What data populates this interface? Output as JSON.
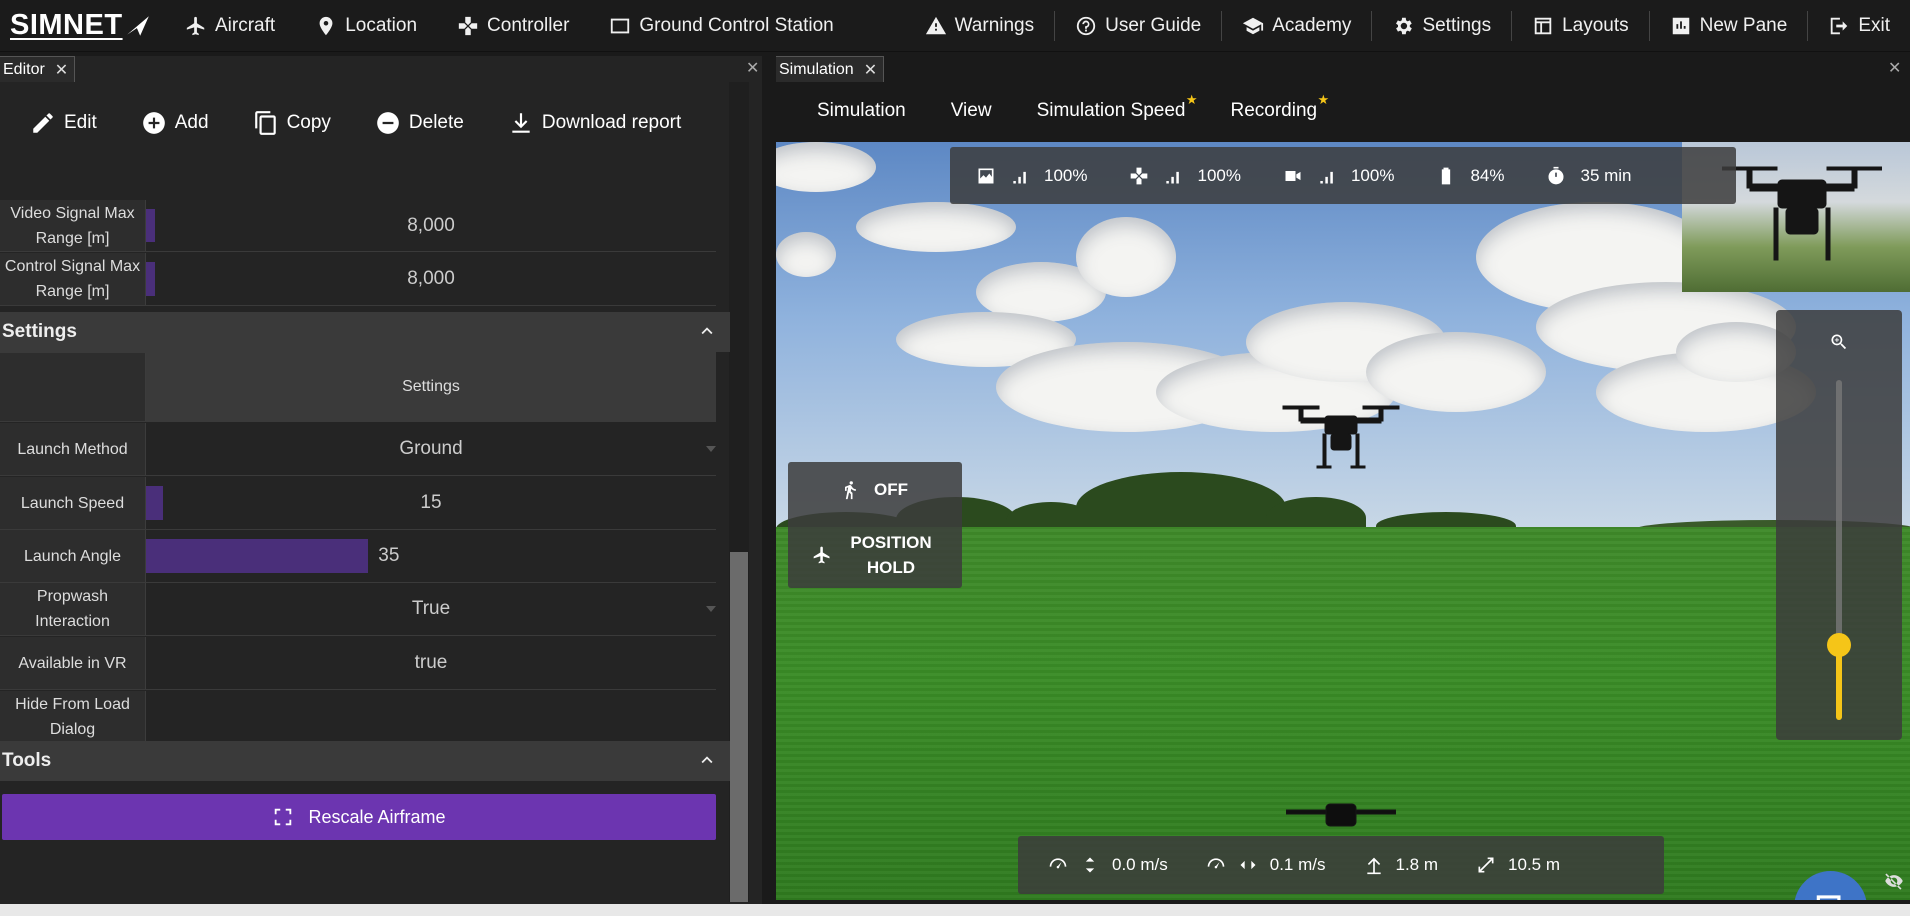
{
  "app": {
    "logo": "SIMNET"
  },
  "nav": {
    "left": [
      {
        "label": "Aircraft",
        "icon": "airplane-icon"
      },
      {
        "label": "Location",
        "icon": "map-pin-icon"
      },
      {
        "label": "Controller",
        "icon": "gamepad-icon"
      },
      {
        "label": "Ground Control Station",
        "icon": "monitor-icon"
      }
    ],
    "right": [
      {
        "label": "Warnings",
        "icon": "warning-icon"
      },
      {
        "label": "User Guide",
        "icon": "help-icon"
      },
      {
        "label": "Academy",
        "icon": "graduation-cap-icon"
      },
      {
        "label": "Settings",
        "icon": "gear-icon"
      },
      {
        "label": "Layouts",
        "icon": "layout-icon"
      },
      {
        "label": "New Pane",
        "icon": "chart-icon"
      },
      {
        "label": "Exit",
        "icon": "exit-icon"
      }
    ]
  },
  "editor": {
    "tab": "Editor",
    "toolbar": {
      "edit": "Edit",
      "add": "Add",
      "copy": "Copy",
      "delete": "Delete",
      "download": "Download report"
    },
    "top_rows": [
      {
        "label": "Video Signal Max Range [m]",
        "value": "8,000",
        "fill": 0.015
      },
      {
        "label": "Control Signal Max Range [m]",
        "value": "8,000",
        "fill": 0.015
      }
    ],
    "settings_section": {
      "title": "Settings",
      "header": "Settings",
      "rows": [
        {
          "label": "Launch Method",
          "value": "Ground",
          "dropdown": true
        },
        {
          "label": "Launch Speed",
          "value": "15",
          "fill": 0.03
        },
        {
          "label": "Launch Angle",
          "value": "35",
          "fill": 0.39
        },
        {
          "label": "Propwash Interaction",
          "value": "True",
          "dropdown": true
        },
        {
          "label": "Available in VR",
          "value": "true"
        },
        {
          "label": "Hide From Load Dialog",
          "value": ""
        }
      ]
    },
    "tools_section": {
      "title": "Tools",
      "rescale": "Rescale Airframe"
    }
  },
  "simulation": {
    "tab": "Simulation",
    "menu": [
      {
        "label": "Simulation",
        "star": false
      },
      {
        "label": "View",
        "star": false
      },
      {
        "label": "Simulation Speed",
        "star": true
      },
      {
        "label": "Recording",
        "star": true
      }
    ],
    "hud_top": {
      "video_signal": "100%",
      "control_signal": "100%",
      "camera_signal": "100%",
      "battery": "84%",
      "time": "35 min"
    },
    "mode": {
      "first": "OFF",
      "second": "POSITION HOLD"
    },
    "hud_bottom": {
      "vertical_speed": "0.0 m/s",
      "horizontal_speed": "0.1 m/s",
      "altitude": "1.8 m",
      "distance": "10.5 m"
    },
    "zoom_level": 0.22,
    "colors": {
      "accent": "#f5c518",
      "purple": "#6c35b0",
      "chat": "#3e74c7"
    }
  }
}
